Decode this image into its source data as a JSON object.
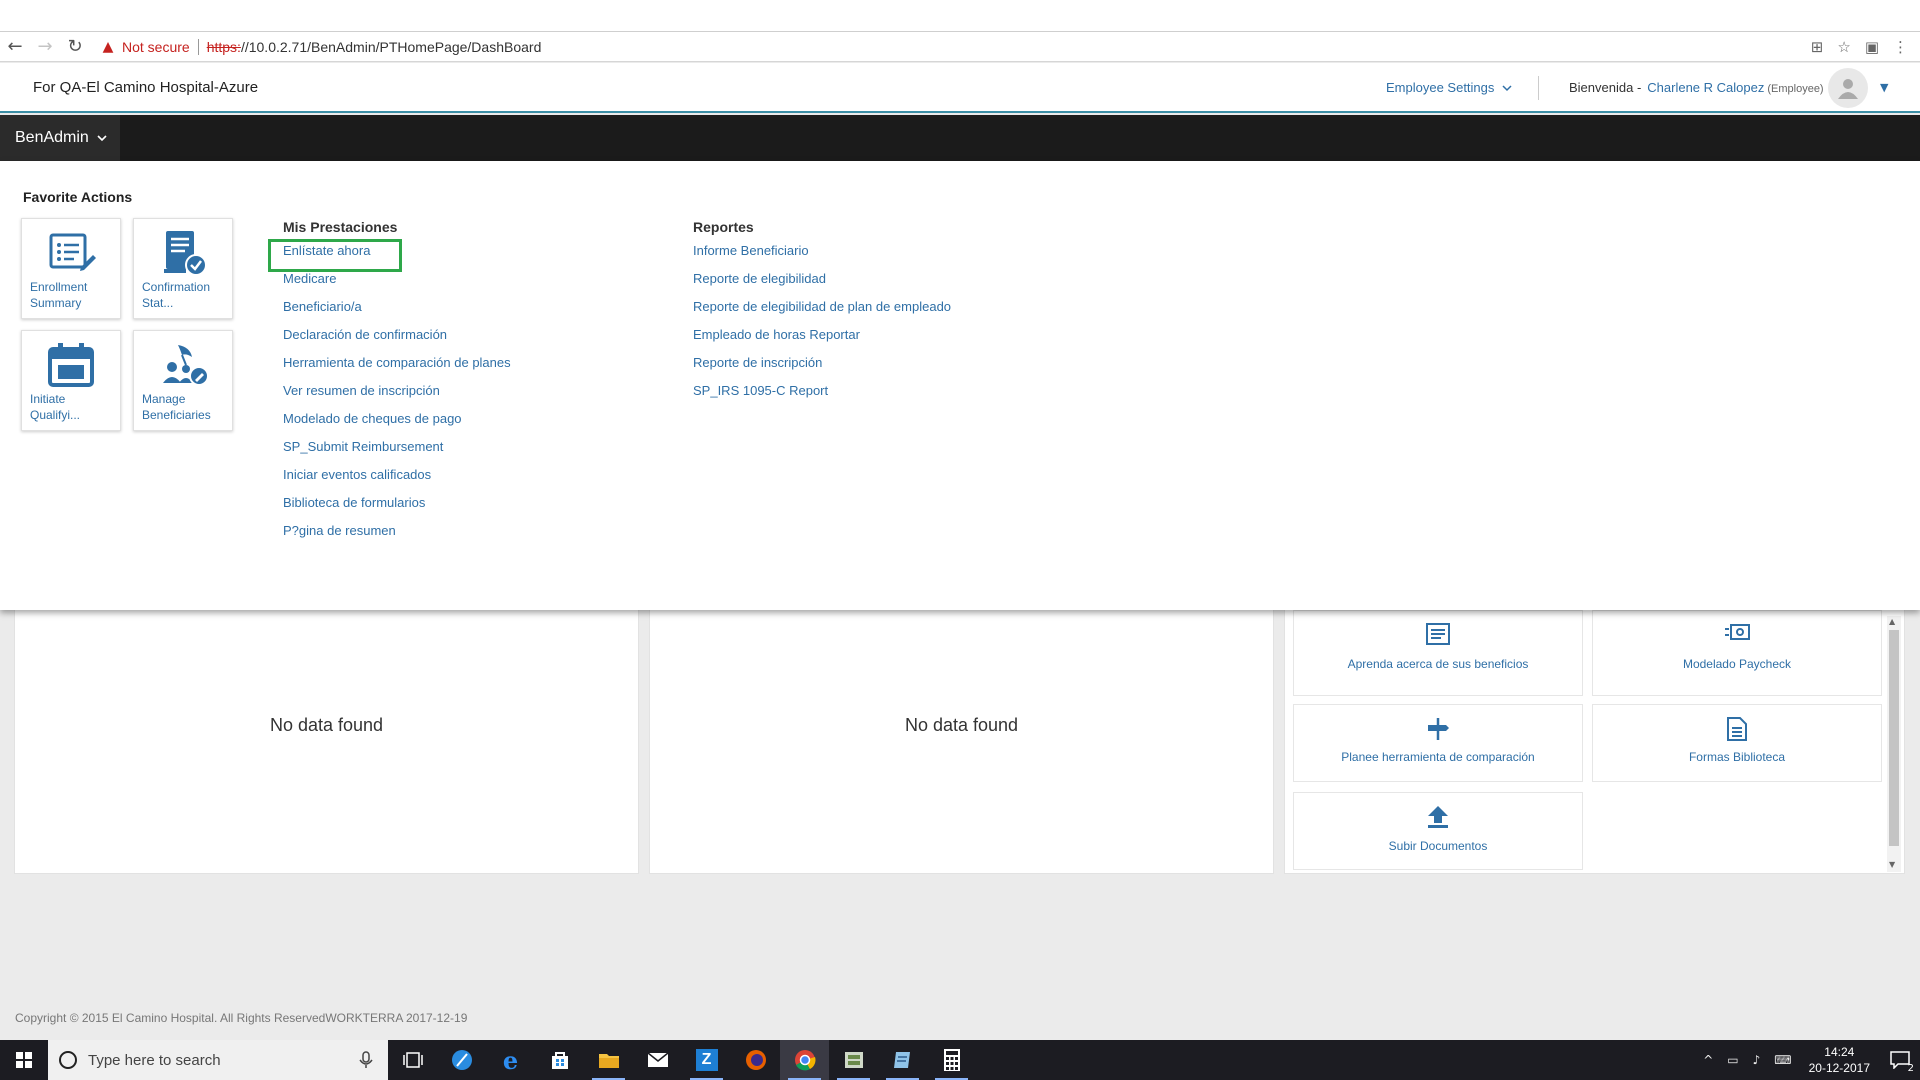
{
  "browser": {
    "security_text": "Not secure",
    "url_scheme": "https:",
    "url_rest": "//10.0.2.71/BenAdmin/PTHomePage/DashBoard"
  },
  "header": {
    "company": "For QA-El Camino Hospital-Azure",
    "employee_settings": "Employee Settings",
    "welcome_prefix": "Bienvenida -",
    "user_name": "Charlene R Calopez",
    "user_role": "(Employee)"
  },
  "nav": {
    "menu_label": "BenAdmin"
  },
  "megamenu": {
    "favorite_title": "Favorite Actions",
    "favorites": [
      {
        "line1": "Enrollment",
        "line2": "Summary",
        "icon": "enrollment-summary-icon"
      },
      {
        "line1": "Confirmation",
        "line2": "Stat...",
        "icon": "confirmation-statement-icon"
      },
      {
        "line1": "Initiate",
        "line2": "Qualifyi...",
        "icon": "calendar-icon"
      },
      {
        "line1": "Manage",
        "line2": "Beneficiaries",
        "icon": "manage-beneficiaries-icon"
      }
    ],
    "col1_title": "Mis Prestaciones",
    "col1_items": [
      "Enlístate ahora",
      "Medicare",
      "Beneficiario/a",
      "Declaración de confirmación",
      "Herramienta de comparación de planes",
      "Ver resumen de inscripción",
      "Modelado de cheques de pago",
      "SP_Submit Reimbursement",
      "Iniciar eventos calificados",
      "Biblioteca de formularios",
      "P?gina de resumen"
    ],
    "col2_title": "Reportes",
    "col2_items": [
      "Informe Beneficiario",
      "Reporte de elegibilidad",
      "Reporte de elegibilidad de plan de empleado",
      "Empleado de horas Reportar",
      "Reporte de inscripción",
      "SP_IRS 1095-C Report"
    ]
  },
  "dashboard": {
    "panel1_text": "No data found",
    "panel2_text": "No data found",
    "quick_links": [
      {
        "label": "Aprenda acerca de sus beneficios",
        "icon": "document-lines-icon"
      },
      {
        "label": "Modelado Paycheck",
        "icon": "money-icon"
      },
      {
        "label": "Planee herramienta de comparación",
        "icon": "signpost-icon"
      },
      {
        "label": "Formas Biblioteca",
        "icon": "forms-icon"
      },
      {
        "label": "Subir Documentos",
        "icon": "upload-icon"
      }
    ]
  },
  "footer": {
    "copyright": "Copyright © 2015 El Camino Hospital. All Rights ReservedWORKTERRA 2017-12-19"
  },
  "taskbar": {
    "search_placeholder": "Type here to search",
    "time": "14:24",
    "date": "20-12-2017",
    "notification_count": "2"
  },
  "colors": {
    "link": "#2f6fa6",
    "nav_bg": "#1b1b1b",
    "highlight": "#2ea84a",
    "accent_line": "#3b8ea5"
  }
}
